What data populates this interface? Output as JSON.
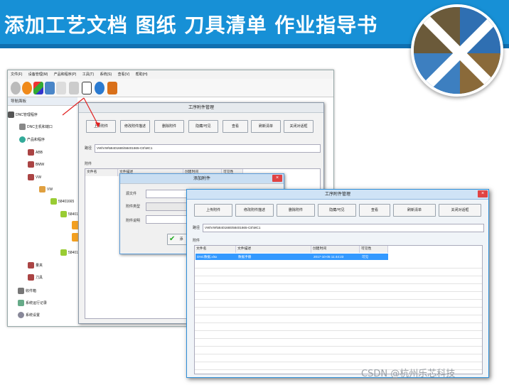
{
  "banner": {
    "title": "添加工艺文档 图纸 刀具清单 作业指导书"
  },
  "app": {
    "menu": [
      "文件(F)",
      "设备管理(M)",
      "产品和程序(P)",
      "工具(T)",
      "系统(S)",
      "查看(V)",
      "帮助(H)"
    ],
    "nav_header": "导航面板",
    "tree": [
      {
        "label": "DNC管理程序"
      },
      {
        "label": "DNC主机和端口"
      },
      {
        "label": "产品和程序"
      },
      {
        "label": "ABB"
      },
      {
        "label": "BMW"
      },
      {
        "label": "VW"
      },
      {
        "label": "VW"
      },
      {
        "label": "58401665"
      },
      {
        "label": "584016"
      },
      {
        "label": "584016"
      },
      {
        "label": "量夹"
      },
      {
        "label": "刀具"
      },
      {
        "label": "收件箱"
      },
      {
        "label": "系统运行记录"
      },
      {
        "label": "系统设置"
      }
    ]
  },
  "dialog_back": {
    "title": "工序附件管理",
    "buttons": [
      "上传附件",
      "修改附件描述",
      "删除附件",
      "隐藏/可见",
      "查看",
      "刷新清单",
      "关闭对话框"
    ],
    "path_label": "路径",
    "path_value": "VW\\VW\\58401665\\58401665-CE\\MC1",
    "attach_label": "附件",
    "columns": [
      "文件名",
      "文件描述",
      "创建时间",
      "可见性"
    ]
  },
  "dialog_add": {
    "title": "添加附件",
    "fields": [
      "源文件",
      "附件类型",
      "附件说明"
    ],
    "ok_label": "添"
  },
  "dialog_front": {
    "title": "工序附件管理",
    "buttons": [
      "上传附件",
      "修改附件描述",
      "删除附件",
      "隐藏/可见",
      "查看",
      "刷新清单",
      "关闭对话框"
    ],
    "path_label": "路径",
    "path_value": "VW\\VW\\58401665\\58401665-CE\\MC1",
    "attach_label": "附件",
    "columns": [
      "文件名",
      "文件描述",
      "创建时间",
      "可见性"
    ],
    "rows": [
      {
        "file": "DNC数据.xlsx",
        "desc": "数据手册",
        "time": "2017-10-05 11:44:23",
        "visible": "可见"
      }
    ]
  },
  "watermark": "CSDN @杭州乐芯科技",
  "colors": {
    "banner": "#1790d6",
    "selection": "#3399ff",
    "close": "#e04343"
  }
}
